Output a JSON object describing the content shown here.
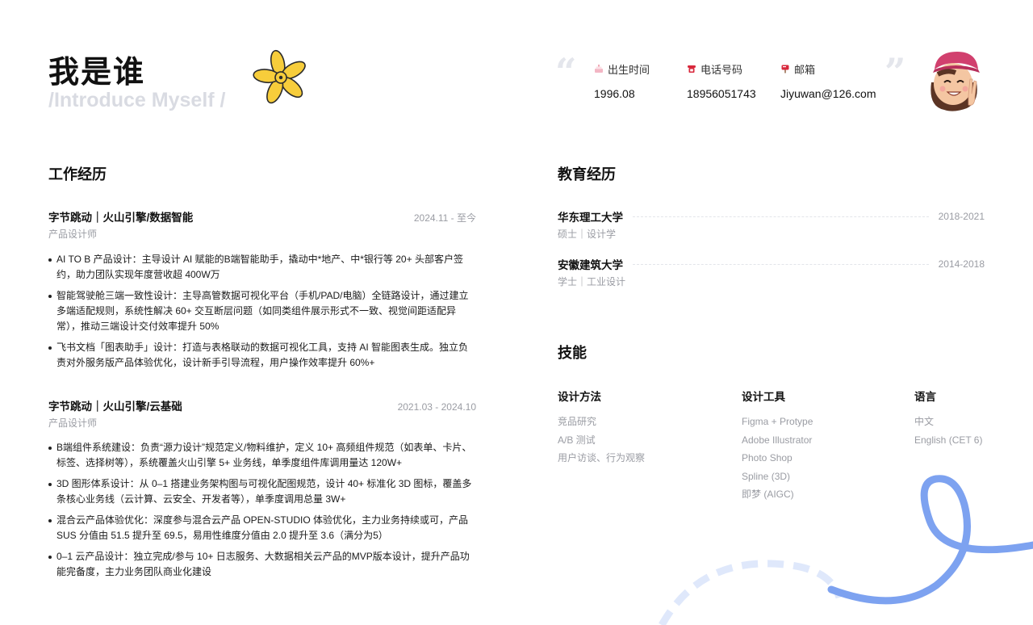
{
  "header": {
    "title": "我是谁",
    "subtitle": "/Introduce Myself /",
    "open_quote": "“",
    "close_quote": "”",
    "info": [
      {
        "icon": "cake-icon",
        "label": "出生时间",
        "value": "1996.08"
      },
      {
        "icon": "telephone-icon",
        "label": "电话号码",
        "value": "18956051743"
      },
      {
        "icon": "mailbox-icon",
        "label": "邮箱",
        "value": "Jiyuwan@126.com"
      }
    ]
  },
  "work": {
    "title": "工作经历",
    "jobs": [
      {
        "company": "字节跳动｜火山引擎/数据智能",
        "date": "2024.11 - 至今",
        "role": "产品设计师",
        "bullets": [
          "AI TO B 产品设计：主导设计 AI 赋能的B端智能助手，撬动中*地产、中*银行等 20+ 头部客户签约，助力团队实现年度营收超 400W万",
          "智能驾驶舱三端一致性设计：主导高管数据可视化平台（手机/PAD/电脑）全链路设计，通过建立多端适配规则，系统性解决 60+ 交互断层问题（如同类组件展示形式不一致、视觉间距适配异常），推动三端设计交付效率提升 50%",
          "飞书文档「图表助手」设计：打造与表格联动的数据可视化工具，支持 AI 智能图表生成。独立负责对外服务版产品体验优化，设计新手引导流程，用户操作效率提升 60%+"
        ]
      },
      {
        "company": "字节跳动｜火山引擎/云基础",
        "date": "2021.03 - 2024.10",
        "role": "产品设计师",
        "bullets": [
          "B端组件系统建设：负责“源力设计”规范定义/物料维护，定义 10+ 高频组件规范（如表单、卡片、标签、选择树等），系统覆盖火山引擎 5+ 业务线，单季度组件库调用量达 120W+",
          "3D 图形体系设计：从 0–1 搭建业务架构图与可视化配图规范，设计 40+ 标准化 3D 图标，覆盖多条核心业务线（云计算、云安全、开发者等），单季度调用总量 3W+",
          "混合云产品体验优化：深度参与混合云产品 OPEN-STUDIO 体验优化，主力业务持续或可，产品 SUS 分值由 51.5 提升至 69.5，易用性维度分值由 2.0 提升至 3.6（满分为5）",
          "0–1 云产品设计：独立完成/参与 10+ 日志服务、大数据相关云产品的MVP版本设计，提升产品功能完备度，主力业务团队商业化建设"
        ]
      }
    ]
  },
  "education": {
    "title": "教育经历",
    "items": [
      {
        "school": "华东理工大学",
        "date": "2018-2021",
        "degree": "硕士｜设计学"
      },
      {
        "school": "安徽建筑大学",
        "date": "2014-2018",
        "degree": "学士｜工业设计"
      }
    ]
  },
  "skills": {
    "title": "技能",
    "columns": [
      {
        "heading": "设计方法",
        "items": [
          "竞品研究",
          "A/B 测试",
          "用户访谈、行为观察"
        ]
      },
      {
        "heading": "设计工具",
        "items": [
          "Figma + Protype",
          "Adobe Illustrator",
          "Photo Shop",
          "Spline (3D)",
          "即梦 (AIGC)"
        ]
      },
      {
        "heading": "语言",
        "items": [
          "中文",
          "English (CET 6)"
        ]
      }
    ]
  },
  "colors": {
    "accent_blue": "#7da2f0",
    "flower_yellow": "#f7cd3b",
    "muted_text": "#9a9ca3",
    "subtitle_gray": "#d9dbe2"
  }
}
